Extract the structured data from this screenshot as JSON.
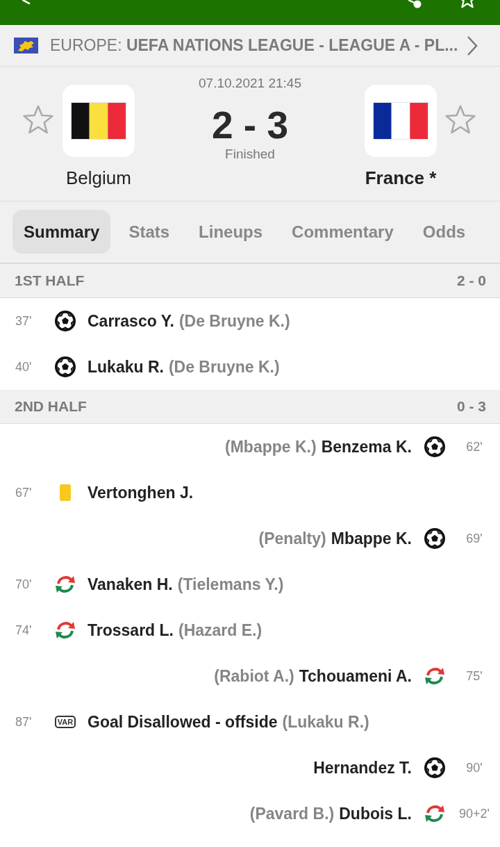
{
  "league": {
    "title": "EUROPE: **UEFA NATIONS LEAGUE - LEAGUE A - PL...**"
  },
  "match": {
    "date": "07.10.2021 21:45",
    "score": "2 - 3",
    "status": "Finished",
    "home": {
      "name": "Belgium",
      "favorite": false,
      "winner": false
    },
    "away": {
      "name": "France *",
      "favorite": false,
      "winner": true
    }
  },
  "tabs": [
    {
      "label": "Summary",
      "selected": true
    },
    {
      "label": "Stats",
      "selected": false
    },
    {
      "label": "Lineups",
      "selected": false
    },
    {
      "label": "Commentary",
      "selected": false
    },
    {
      "label": "Odds",
      "selected": false
    }
  ],
  "periods": [
    {
      "title": "1ST HALF",
      "score": "2 - 0",
      "events": [
        {
          "away": false,
          "minute": "37'",
          "kind": "goal",
          "player": "Carrasco Y.",
          "detail": "(De Bruyne K.)"
        },
        {
          "away": false,
          "minute": "40'",
          "kind": "goal",
          "player": "Lukaku R.",
          "detail": "(De Bruyne K.)"
        }
      ]
    },
    {
      "title": "2ND HALF",
      "score": "0 - 3",
      "events": [
        {
          "away": true,
          "minute": "62'",
          "kind": "goal",
          "player": "Benzema K.",
          "detail": "(Mbappe K.)"
        },
        {
          "away": false,
          "minute": "67'",
          "kind": "yellow_card",
          "player": "Vertonghen J."
        },
        {
          "away": true,
          "minute": "69'",
          "kind": "goal",
          "player": "Mbappe K.",
          "detail": "(Penalty)"
        },
        {
          "away": false,
          "minute": "70'",
          "kind": "substitution",
          "player": "Vanaken H.",
          "detail": "(Tielemans Y.)"
        },
        {
          "away": false,
          "minute": "74'",
          "kind": "substitution",
          "player": "Trossard L.",
          "detail": "(Hazard E.)"
        },
        {
          "away": true,
          "minute": "75'",
          "kind": "substitution",
          "player": "Tchouameni A.",
          "detail": "(Rabiot A.)"
        },
        {
          "away": false,
          "minute": "87'",
          "kind": "var",
          "badge": "VAR",
          "player": "Goal Disallowed - offside",
          "detail": "(Lukaku R.)"
        },
        {
          "away": true,
          "minute": "90'",
          "kind": "goal",
          "player": "Hernandez T."
        },
        {
          "away": true,
          "minute": "90+2'",
          "kind": "substitution",
          "player": "Dubois L.",
          "detail": "(Pavard B.)"
        }
      ]
    }
  ]
}
